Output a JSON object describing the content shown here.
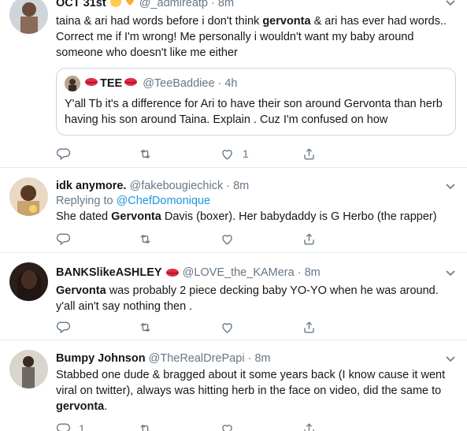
{
  "tweets": [
    {
      "name": "OCT 31st",
      "handle": "@_admireatp",
      "sep": "·",
      "time": "8m",
      "text_parts": [
        "taina & ari had words before i don't think ",
        "gervonta",
        " & ari has ever had words.. Correct me if I'm wrong! Me personally i wouldn't want my baby around someone who doesn't like me either"
      ],
      "quote": {
        "name": "TEE",
        "handle": "@TeeBaddiee",
        "sep": "·",
        "time": "4h",
        "text": "Y'all Tb it's a difference for Ari to have their son around Gervonta than herb having his son around Taina. Explain . Cuz I'm confused on how"
      },
      "likes": "1"
    },
    {
      "name": "idk anymore.",
      "handle": "@fakebougiechick",
      "sep": "·",
      "time": "8m",
      "replying_prefix": "Replying to ",
      "replying_to": "@ChefDomonique",
      "text_parts": [
        "She dated ",
        "Gervonta",
        " Davis (boxer). Her babydaddy is G Herbo (the rapper)"
      ]
    },
    {
      "name": "BANKSlikeASHLEY",
      "handle": "@LOVE_the_KAMera",
      "sep": "·",
      "time": "8m",
      "text_parts": [
        "",
        "Gervonta",
        " was probably 2 piece decking  baby YO-YO when he was around. y'all ain't say nothing then ."
      ]
    },
    {
      "name": "Bumpy Johnson",
      "handle": "@TheRealDrePapi",
      "sep": "·",
      "time": "8m",
      "text_parts": [
        "Stabbed one dude & bragged about it some years back (I know cause it went viral on twitter), always was hitting herb in the face on video, did the same to ",
        "gervonta",
        "."
      ],
      "replies": "1"
    }
  ],
  "icons": {
    "reply": "reply-icon",
    "retweet": "retweet-icon",
    "like": "like-icon",
    "share": "share-icon",
    "more": "chevron-down-icon"
  },
  "colors": {
    "link": "#1b95e0",
    "muted": "#657786",
    "text": "#14171a",
    "border": "#e6ecf0"
  }
}
